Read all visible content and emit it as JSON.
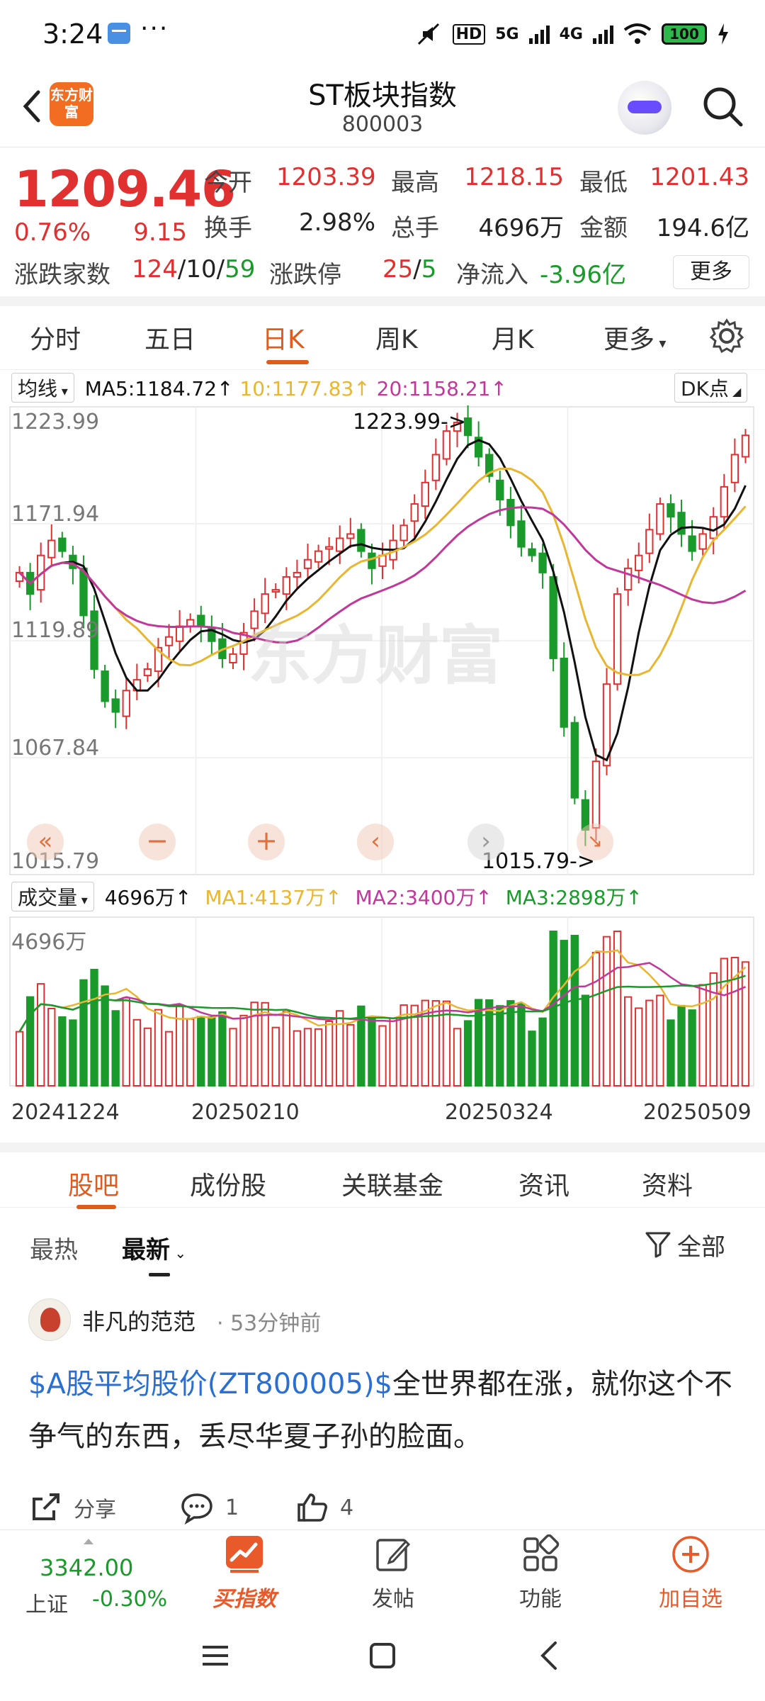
{
  "status_bar": {
    "time": "3:24",
    "network_hd": "HD",
    "network_5g": "5G",
    "network_4g": "4G",
    "battery": "100"
  },
  "header": {
    "brand": "东方财富",
    "title": "ST板块指数",
    "code": "800003"
  },
  "quote": {
    "price": "1209.46",
    "change_pct": "0.76%",
    "change": "9.15",
    "open_label": "今开",
    "open": "1203.39",
    "high_label": "最高",
    "high": "1218.15",
    "low_label": "最低",
    "low": "1201.43",
    "turnover_label": "换手",
    "turnover": "2.98%",
    "volume_label": "总手",
    "volume": "4696万",
    "amount_label": "金额",
    "amount": "194.6亿",
    "breadth_label": "涨跌家数",
    "breadth_up": "124",
    "breadth_flat": "10",
    "breadth_down": "59",
    "breadth_sep": "/",
    "limit_label": "涨跌停",
    "limit_up": "25",
    "limit_down": "5",
    "netflow_label": "净流入",
    "netflow": "-3.96亿",
    "more_label": "更多"
  },
  "period_tabs": [
    "分时",
    "五日",
    "日K",
    "周K",
    "月K",
    "更多"
  ],
  "active_period": "日K",
  "chart": {
    "ma_selector": "均线",
    "ma5": "MA5:1184.72↑",
    "ma10": "10:1177.83↑",
    "ma20": "20:1158.21↑",
    "dk_label": "DK点",
    "price_ticks": [
      "1223.99",
      "1171.94",
      "1119.89",
      "1067.84",
      "1015.79"
    ],
    "high_marker": "1223.99->",
    "low_marker": "1015.79->",
    "watermark": "东方财富",
    "vol_selector": "成交量",
    "vol_value": "4696万↑",
    "vol_ma1": "MA1:4137万↑",
    "vol_ma2": "MA2:3400万↑",
    "vol_ma3": "MA3:2898万↑",
    "vol_tick": "4696万",
    "dates": [
      "20241224",
      "20250210",
      "20250324",
      "20250509"
    ],
    "colors": {
      "up": "#e03030",
      "down": "#1a9a2a",
      "ma5": "#111111",
      "ma10": "#e8b631",
      "ma20": "#c0399a"
    }
  },
  "chart_data": {
    "type": "candlestick",
    "title": "ST板块指数",
    "y_range": [
      1015.79,
      1223.99
    ],
    "close_approx": [
      1150,
      1140,
      1158,
      1165,
      1160,
      1152,
      1130,
      1105,
      1090,
      1085,
      1095,
      1100,
      1105,
      1115,
      1120,
      1125,
      1128,
      1125,
      1118,
      1110,
      1112,
      1122,
      1132,
      1140,
      1142,
      1148,
      1150,
      1156,
      1160,
      1162,
      1166,
      1168,
      1160,
      1152,
      1158,
      1165,
      1172,
      1182,
      1192,
      1205,
      1216,
      1220,
      1214,
      1204,
      1195,
      1184,
      1172,
      1162,
      1158,
      1150,
      1110,
      1078,
      1045,
      1030,
      1062,
      1098,
      1140,
      1152,
      1158,
      1170,
      1182,
      1176,
      1168,
      1160,
      1168,
      1176,
      1190,
      1205,
      1214
    ]
  },
  "section_tabs": [
    "股吧",
    "成份股",
    "关联基金",
    "资讯",
    "资料"
  ],
  "active_section": "股吧",
  "sort": {
    "hot": "最热",
    "new": "最新",
    "filter": "全部"
  },
  "post": {
    "user": "非凡的范范",
    "time": "· 53分钟前",
    "link": "$A股平均股价(ZT800005)$",
    "text": "全世界都在涨，就你这个不争气的东西，丢尽华夏子孙的脸面。",
    "share": "分享",
    "comments": "1",
    "likes": "4"
  },
  "bottom_bar": {
    "index_value": "3342.00",
    "index_name": "上证",
    "index_change": "-0.30%",
    "buy": "买指数",
    "post": "发帖",
    "func": "功能",
    "add": "加自选"
  }
}
